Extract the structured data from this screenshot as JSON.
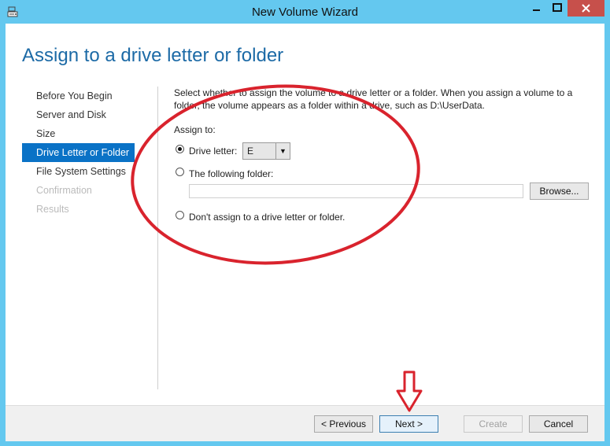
{
  "window": {
    "title": "New Volume Wizard",
    "controls": [
      "minimize",
      "maximize",
      "close"
    ],
    "accent_color": "#64c8ef",
    "close_color": "#c7504b"
  },
  "page": {
    "heading": "Assign to a drive letter or folder"
  },
  "nav": {
    "items": [
      {
        "label": "Before You Begin",
        "state": "normal"
      },
      {
        "label": "Server and Disk",
        "state": "normal"
      },
      {
        "label": "Size",
        "state": "normal"
      },
      {
        "label": "Drive Letter or Folder",
        "state": "active"
      },
      {
        "label": "File System Settings",
        "state": "normal"
      },
      {
        "label": "Confirmation",
        "state": "disabled"
      },
      {
        "label": "Results",
        "state": "disabled"
      }
    ],
    "active_color": "#0a72c6"
  },
  "content": {
    "description": "Select whether to assign the volume to a drive letter or a folder. When you assign a volume to a folder, the volume appears as a folder within a drive, such as D:\\UserData.",
    "assign_to_label": "Assign to:",
    "options": {
      "drive_letter": {
        "label": "Drive letter:",
        "selected": true,
        "value": "E"
      },
      "folder": {
        "label": "The following folder:",
        "selected": false,
        "value": ""
      },
      "none": {
        "label": "Don't assign to a drive letter or folder.",
        "selected": false
      }
    },
    "browse_label": "Browse..."
  },
  "footer": {
    "previous_label": "< Previous",
    "next_label": "Next >",
    "create_label": "Create",
    "cancel_label": "Cancel"
  },
  "annotations": {
    "highlight_color": "#d9232d"
  }
}
